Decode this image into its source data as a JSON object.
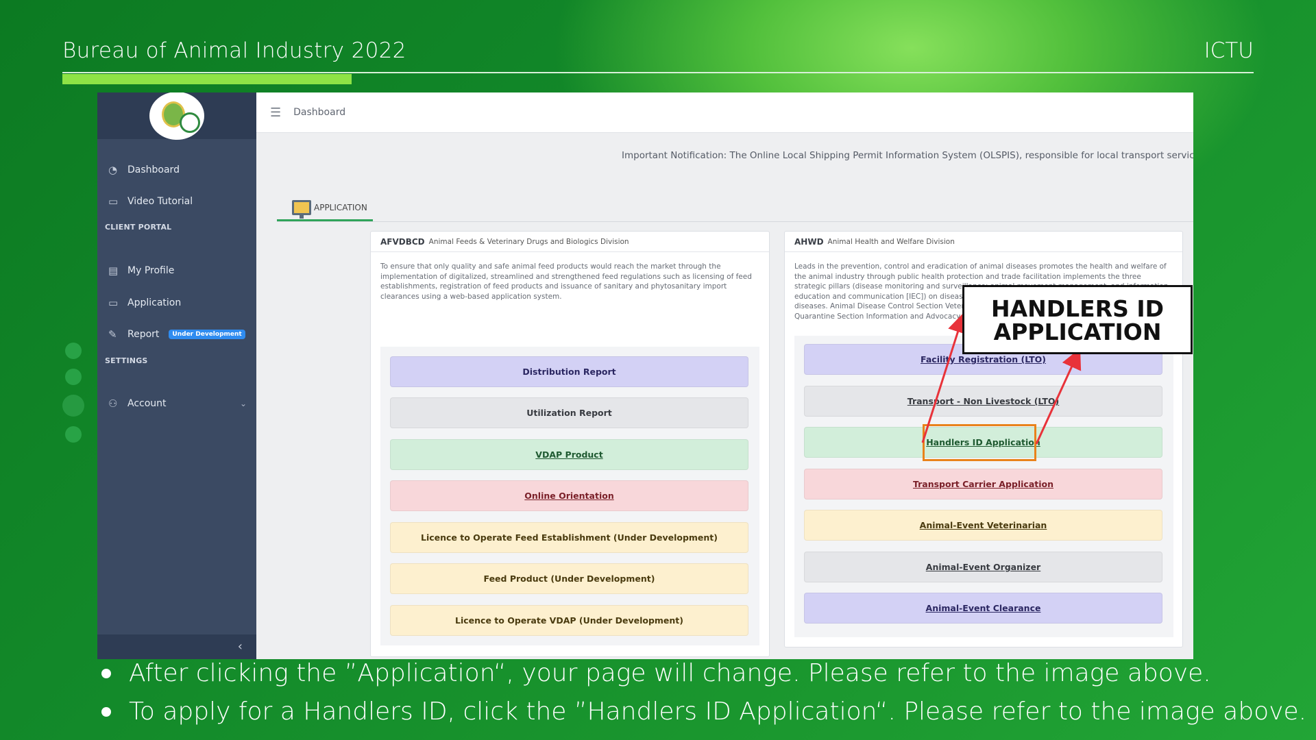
{
  "slide": {
    "title": "Bureau of Animal Industry 2022",
    "tag": "ICTU",
    "bullets": [
      "After clicking the ”Application“, your page will change. Please refer to the image above.",
      "To apply for a Handlers ID, click the ”Handlers ID Application“. Please refer to the image above."
    ]
  },
  "sidebar": {
    "items": [
      {
        "label": "Dashboard",
        "icon": "gauge-icon"
      },
      {
        "label": "Video Tutorial",
        "icon": "video-icon"
      },
      {
        "label": "My Profile",
        "icon": "id-card-icon"
      },
      {
        "label": "Application",
        "icon": "monitor-icon"
      },
      {
        "label": "Report",
        "icon": "pencil-icon",
        "badge": "Under Development"
      },
      {
        "label": "Account",
        "icon": "user-icon"
      }
    ],
    "sections": [
      "CLIENT PORTAL",
      "SETTINGS"
    ],
    "collapse_glyph": "‹"
  },
  "topbar": {
    "breadcrumb": "Dashboard",
    "menu_glyph": "☰"
  },
  "notice": "Important Notification: The Online Local Shipping Permit Information System (OLSPIS), responsible for local transport services, is c",
  "tab": {
    "label": "APPLICATION"
  },
  "cards": {
    "left": {
      "code": "AFVDBCD",
      "name": "Animal Feeds & Veterinary Drugs and Biologics Division",
      "desc": "To ensure that only quality and safe animal feed products would reach the market through the implementation of digitalized, streamlined and strengthened feed regulations such as licensing of feed establishments, registration of feed products and issuance of sanitary and phytosanitary import clearances using a web-based application system.",
      "buttons": [
        "Distribution Report",
        "Utilization Report",
        "VDAP Product",
        "Online Orientation",
        "Licence to Operate Feed Establishment (Under Development)",
        "Feed Product (Under Development)",
        "Licence to Operate VDAP (Under Development)"
      ]
    },
    "right": {
      "code": "AHWD",
      "name": "Animal Health and Welfare Division",
      "desc": "Leads in the prevention, control and eradication of animal diseases promotes the health and welfare of the animal industry through public health protection and trade facilitation implements the three strategic pillars (disease monitoring and surveillance; animal movement management, and information, education and communication [IEC]) on disease prevention and control program of priority animal diseases. Animal Disease Control Section Veterinary Epidemiology Section Animal Facilities Section Quarantine Section Information and Advocacy (Animal Welfare) Services Section",
      "buttons": [
        "Facility Registration (LTO)",
        "Transport - Non Livestock (LTO)",
        "Handlers ID Application",
        "Transport Carrier Application",
        "Animal-Event Veterinarian",
        "Animal-Event Organizer",
        "Animal-Event Clearance"
      ]
    }
  },
  "callout": {
    "line1": "HANDLERS ID",
    "line2": "APPLICATION"
  },
  "colors": {
    "accent_green": "#8ee346",
    "sidebar": "#3b4a63",
    "highlight": "#e9821b",
    "arrow": "#e8323a"
  }
}
